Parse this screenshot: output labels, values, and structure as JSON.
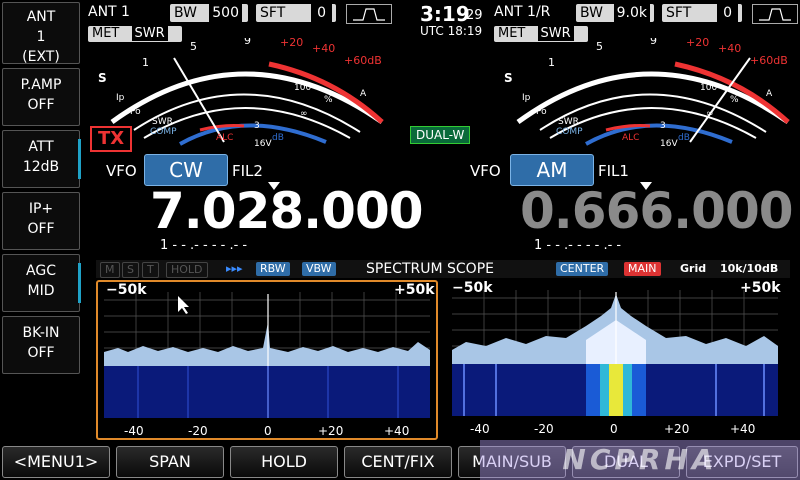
{
  "side_menu": [
    {
      "label": "ANT",
      "line2": "1",
      "line3": "(EXT)"
    },
    {
      "label": "P.AMP",
      "line2": "OFF"
    },
    {
      "label": "ATT",
      "line2": "12dB"
    },
    {
      "label": "IP+",
      "line2": "OFF"
    },
    {
      "label": "AGC",
      "line2": "MID"
    },
    {
      "label": "BK-IN",
      "line2": "OFF"
    }
  ],
  "main_header": {
    "ant": "ANT 1",
    "bw_label": "BW",
    "bw_value": "500",
    "sft_label": "SFT",
    "sft_value": "0"
  },
  "sub_header": {
    "ant": "ANT 1/R",
    "bw_label": "BW",
    "bw_value": "9.0k",
    "sft_label": "SFT",
    "sft_value": "0"
  },
  "clock": {
    "time": "3:19",
    "seconds": "29",
    "utc": "UTC 18:19"
  },
  "meter_left": {
    "met": "MET",
    "swr": "SWR"
  },
  "meter_right": {
    "met": "MET",
    "swr": "SWR"
  },
  "meter_labels": {
    "s": "S",
    "ip": "Ip",
    "po": "Po",
    "swr": "SWR",
    "comp": "COMP",
    "alc": "ALC",
    "s_scale": [
      "1",
      "3",
      "5",
      "7",
      "9",
      "+20",
      "+40",
      "+60dB"
    ],
    "ip_scale": [
      "0",
      "5",
      "10",
      "15",
      "20",
      "25",
      "A"
    ],
    "po_scale": [
      "0",
      "10",
      "25",
      "50",
      "100",
      "%"
    ],
    "swr_scale": [
      "1",
      "1.5",
      "2",
      "3",
      "∞"
    ],
    "comp_scale": [
      "0",
      "10",
      "20",
      "dB"
    ],
    "vd_scale": [
      "10",
      "15",
      "16V",
      "Vd"
    ],
    "alc_marks": "ALC"
  },
  "tx_badge": "TX",
  "dualw_badge": "DUAL-W",
  "vfo_main": {
    "vfo": "VFO",
    "mode": "CW",
    "fil": "FIL2",
    "freq": "7.028.000",
    "mem": "1 - - .- - - - .- -"
  },
  "vfo_sub": {
    "vfo": "VFO",
    "mode": "AM",
    "fil": "FIL1",
    "freq": "0.666.000",
    "mem": "1 - - .- - - - .- -"
  },
  "scope_bar": {
    "m": "M",
    "s": "S",
    "t": "T",
    "hold": "HOLD",
    "arrows": "▸▸▸",
    "rbw": "RBW",
    "vbw": "VBW",
    "title": "SPECTRUM SCOPE",
    "center": "CENTER",
    "main": "MAIN",
    "grid": "Grid",
    "span": "10k/10dB"
  },
  "scope_left": {
    "left": "−50k",
    "right": "+50k",
    "ticks": [
      "-40",
      "-20",
      "0",
      "+20",
      "+40"
    ]
  },
  "scope_right": {
    "left": "−50k",
    "right": "+50k",
    "ticks": [
      "-40",
      "-20",
      "0",
      "+20",
      "+40"
    ]
  },
  "bottom_menu": [
    "<MENU1>",
    "SPAN",
    "HOLD",
    "CENT/FIX",
    "MAIN/SUB",
    "DUAL",
    "EXPD/SET"
  ],
  "watermark": "NCPRHA",
  "colors": {
    "accent": "#2f6da8",
    "tx": "#e33333",
    "scope_fill": "#a9c6e6",
    "highlight": "#e08a2a"
  }
}
